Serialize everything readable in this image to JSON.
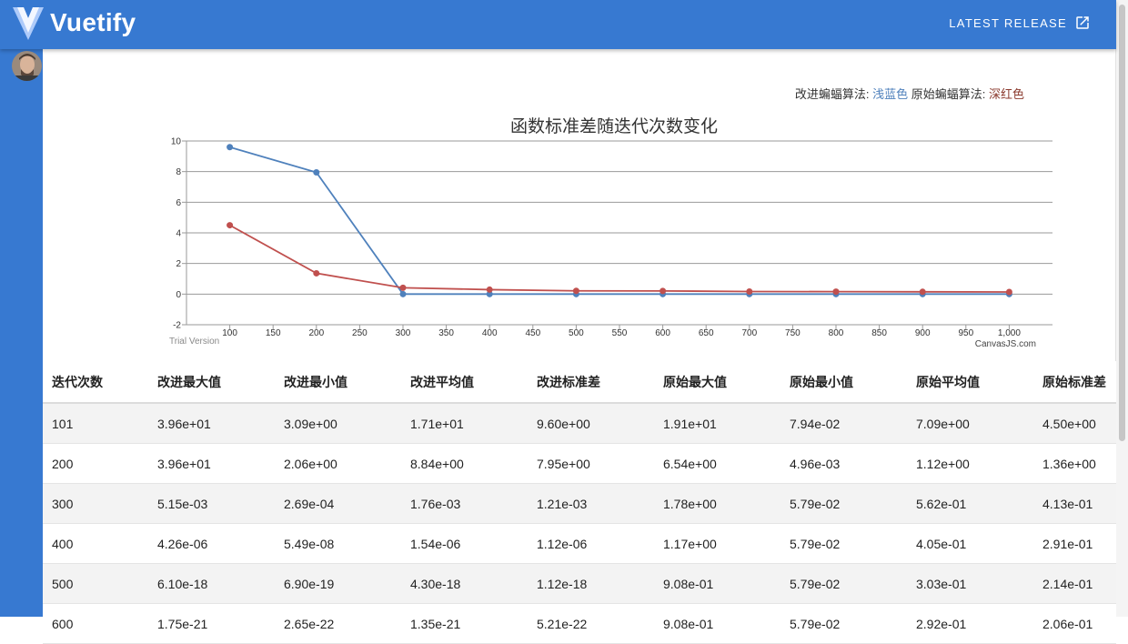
{
  "app": {
    "brand": "Vuetify",
    "release_label": "LATEST RELEASE"
  },
  "nav": {
    "icons": [
      "airplay-icon",
      "dashboard-icon",
      "image-icon"
    ]
  },
  "legend_note": {
    "improved_label": "改进蝙蝠算法: ",
    "improved_color_name": "浅蓝色",
    "original_label": " 原始蝙蝠算法: ",
    "original_color_name": "深红色"
  },
  "colors": {
    "appbar": "#3779d1",
    "improved": "#4f81bc",
    "original": "#c0504e"
  },
  "chart_data": {
    "type": "line",
    "title": "函数标准差随迭代次数变化",
    "xlabel": "",
    "ylabel": "",
    "xlim": [
      50,
      1050
    ],
    "ylim": [
      -2,
      10
    ],
    "x_ticks": [
      100,
      150,
      200,
      250,
      300,
      350,
      400,
      450,
      500,
      550,
      600,
      650,
      700,
      750,
      800,
      850,
      900,
      950,
      1000
    ],
    "x_tick_labels": [
      "100",
      "150",
      "200",
      "250",
      "300",
      "350",
      "400",
      "450",
      "500",
      "550",
      "600",
      "650",
      "700",
      "750",
      "800",
      "850",
      "900",
      "950",
      "1,000"
    ],
    "y_ticks": [
      -2,
      0,
      2,
      4,
      6,
      8,
      10
    ],
    "y_tick_labels": [
      "-2",
      "0",
      "2",
      "4",
      "6",
      "8",
      "10"
    ],
    "grid": true,
    "series": [
      {
        "x": [
          100,
          200,
          300,
          400,
          500,
          600,
          700,
          800,
          900,
          1000
        ],
        "values": [
          9.6,
          7.95,
          0.00121,
          1.12e-06,
          1.12e-18,
          5.21e-22,
          0,
          0,
          0,
          0
        ],
        "color": "#4f81bc"
      },
      {
        "x": [
          100,
          200,
          300,
          400,
          500,
          600,
          700,
          800,
          900,
          1000
        ],
        "values": [
          4.5,
          1.36,
          0.413,
          0.291,
          0.214,
          0.206,
          0.17,
          0.16,
          0.15,
          0.14
        ],
        "color": "#c0504e"
      }
    ],
    "watermark_left": "Trial Version",
    "watermark_right": "CanvasJS.com"
  },
  "table": {
    "headers": [
      "迭代次数",
      "改进最大值",
      "改进最小值",
      "改进平均值",
      "改进标准差",
      "原始最大值",
      "原始最小值",
      "原始平均值",
      "原始标准差"
    ],
    "rows": [
      [
        "101",
        "3.96e+01",
        "3.09e+00",
        "1.71e+01",
        "9.60e+00",
        "1.91e+01",
        "7.94e-02",
        "7.09e+00",
        "4.50e+00"
      ],
      [
        "200",
        "3.96e+01",
        "2.06e+00",
        "8.84e+00",
        "7.95e+00",
        "6.54e+00",
        "4.96e-03",
        "1.12e+00",
        "1.36e+00"
      ],
      [
        "300",
        "5.15e-03",
        "2.69e-04",
        "1.76e-03",
        "1.21e-03",
        "1.78e+00",
        "5.79e-02",
        "5.62e-01",
        "4.13e-01"
      ],
      [
        "400",
        "4.26e-06",
        "5.49e-08",
        "1.54e-06",
        "1.12e-06",
        "1.17e+00",
        "5.79e-02",
        "4.05e-01",
        "2.91e-01"
      ],
      [
        "500",
        "6.10e-18",
        "6.90e-19",
        "4.30e-18",
        "1.12e-18",
        "9.08e-01",
        "5.79e-02",
        "3.03e-01",
        "2.14e-01"
      ],
      [
        "600",
        "1.75e-21",
        "2.65e-22",
        "1.35e-21",
        "5.21e-22",
        "9.08e-01",
        "5.79e-02",
        "2.92e-01",
        "2.06e-01"
      ]
    ]
  }
}
